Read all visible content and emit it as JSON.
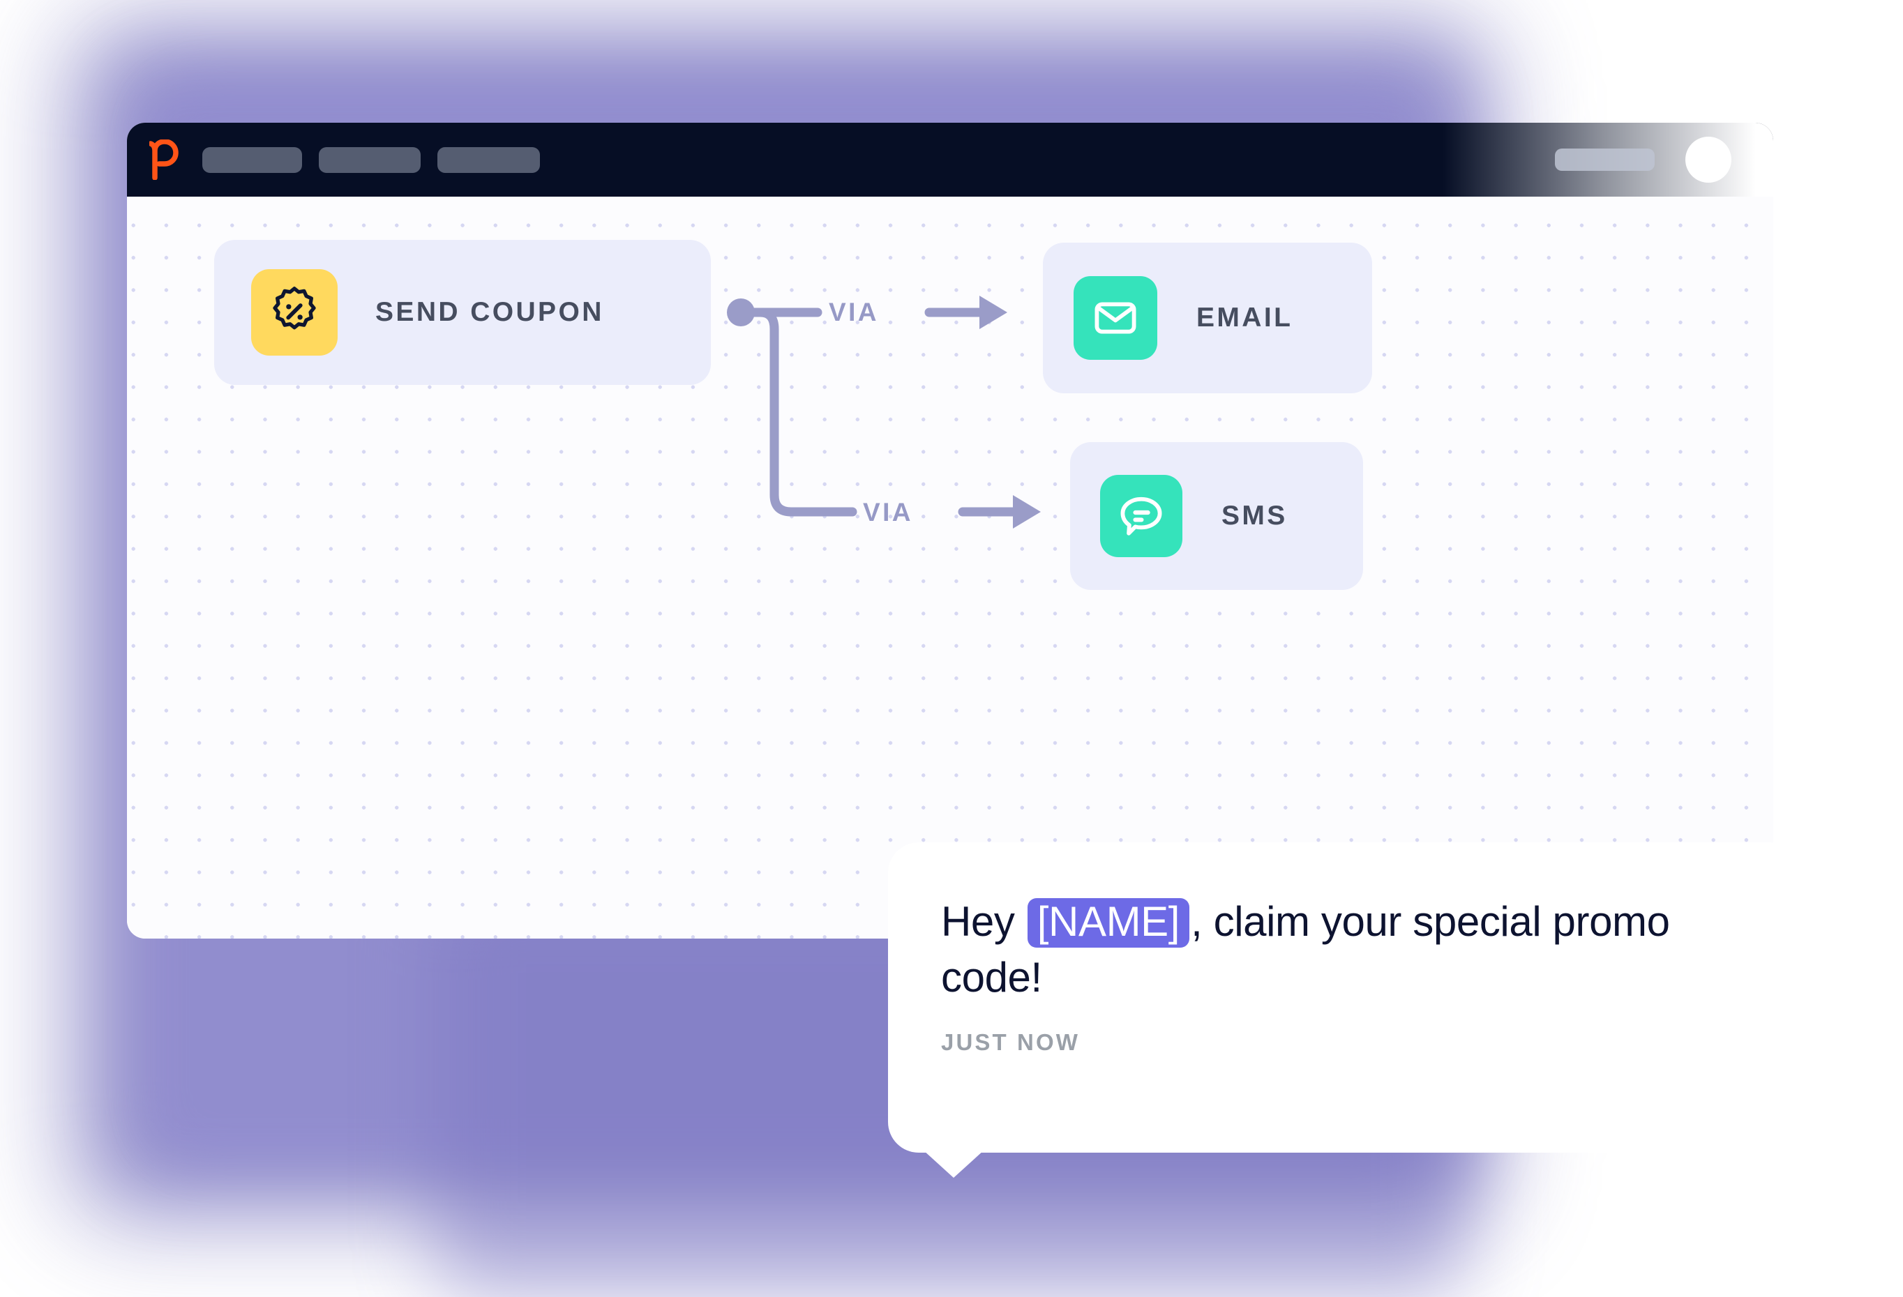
{
  "window": {
    "titlebar": {
      "logo_icon": "brand-p-logo-icon",
      "logo_color": "#ff5417",
      "background_color": "#060e25",
      "nav_placeholders": [
        "",
        "",
        ""
      ],
      "right_placeholder": "",
      "avatar_label": ""
    }
  },
  "canvas": {
    "background_color": "#fcfcfe",
    "dot_color": "#d6d7f2",
    "connector_color": "#9a9cc8"
  },
  "flow": {
    "nodes": [
      {
        "id": "send-coupon",
        "label": "SEND COUPON",
        "icon": "coupon-percent-badge-icon",
        "icon_bg": "#ffd95e",
        "card_bg": "#ebedfb"
      },
      {
        "id": "email",
        "label": "EMAIL",
        "icon": "envelope-icon",
        "icon_bg": "#35e3bb",
        "card_bg": "#ebedfb"
      },
      {
        "id": "sms",
        "label": "SMS",
        "icon": "chat-bubble-icon",
        "icon_bg": "#35e3bb",
        "card_bg": "#ebedfb"
      }
    ],
    "connectors": [
      {
        "id": "via-email",
        "label": "VIA",
        "arrow_icon": "arrow-right-icon",
        "from": "send-coupon",
        "to": "email"
      },
      {
        "id": "via-sms",
        "label": "VIA",
        "arrow_icon": "arrow-right-icon",
        "from": "send-coupon",
        "to": "sms"
      }
    ]
  },
  "message_bubble": {
    "text_before": "Hey",
    "token": "[NAME]",
    "text_after": ", claim your special promo code!",
    "token_color": "#6d6ae6",
    "timestamp": "JUST NOW"
  }
}
